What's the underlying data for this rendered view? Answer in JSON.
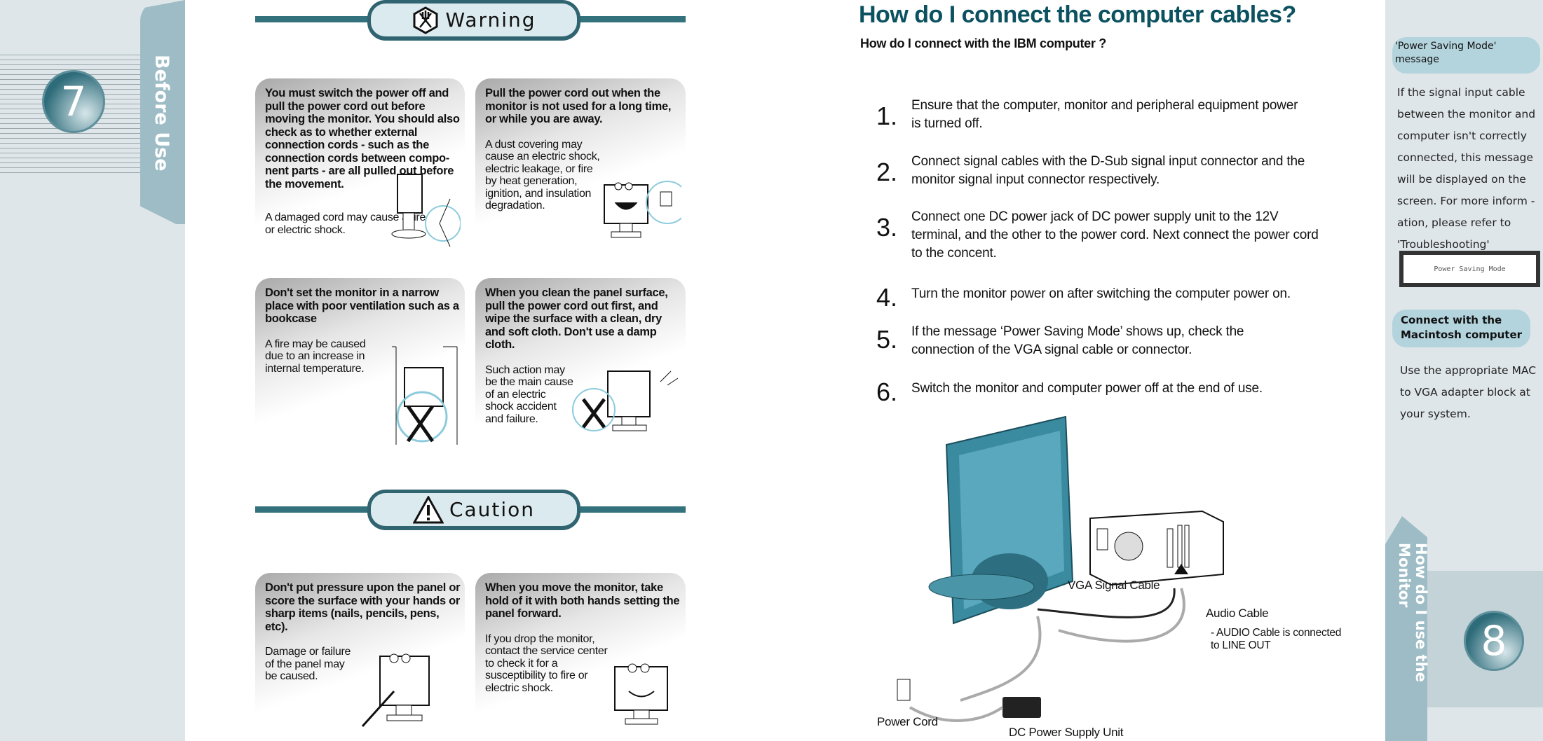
{
  "left_page": {
    "page_number": "7",
    "section_tab": "Before Use",
    "warning_heading": "Warning",
    "caution_heading": "Caution",
    "warning_cards": [
      {
        "heading": "You must switch the power off and pull the  power cord out before moving the monitor. You should also check as to whether external connection cords - such as the connection cords between compo-nent parts - are all pulled out before the movement.",
        "body": "A damaged cord may cause a fire or electric shock."
      },
      {
        "heading": "Pull the power cord out when the monitor is not used for a long time, or  while you are away.",
        "body": "A dust covering may cause an electric shock, electric leakage, or fire  by heat generation, ignition, and insulation degradation."
      },
      {
        "heading": "Don't set  the  monitor in   a narrow place   with poor  ventilation such as  a bookcase",
        "body": "A fire may be caused due to an increase in internal temperature."
      },
      {
        "heading": "When you clean the panel surface, pull the power cord  out first, and wipe the surface with a clean, dry and soft cloth. Don't use a damp cloth.",
        "body": "Such action may be the main cause of an electric shock accident and failure."
      }
    ],
    "caution_cards": [
      {
        "heading": "Don't put pressure  upon the  panel or  score the  surface with  your hands or sharp items (nails, pencils, pens, etc).",
        "body": "Damage or failure of the panel may be caused."
      },
      {
        "heading": "When you move the monitor, take hold  of it with both hands setting the panel forward.",
        "body": "If  you  drop  the  monitor, contact  the  service center   to check it for a susceptibility to fire or electric shock."
      }
    ]
  },
  "right_page": {
    "title": "How do I connect the computer cables?",
    "subtitle": "How do I connect with the IBM computer ?",
    "steps": [
      {
        "num": "1.",
        "text": "Ensure that the computer, monitor  and peripheral equipment power is turned off."
      },
      {
        "num": "2.",
        "text": "Connect signal cables with the D-Sub signal input connector  and the monitor signal input connector respectively."
      },
      {
        "num": "3.",
        "text": "Connect one DC power jack of DC  power supply unit  to the 12V terminal, and  the other to the power cord. Next connect the power cord to the concent."
      },
      {
        "num": "4.",
        "text": "Turn the monitor power on after switching the computer power on."
      },
      {
        "num": "5.",
        "text": "If the  message ‘Power Saving Mode’ shows up, check  the  connection of the VGA signal cable or connector."
      },
      {
        "num": "6.",
        "text": "Switch the monitor and computer power off at the end of use."
      }
    ],
    "diagram_labels": {
      "vga": "VGA Signal Cable",
      "audio": "Audio Cable",
      "audio_note": "- AUDIO Cable is connected to LINE OUT",
      "power_cord": "Power Cord",
      "dc_unit": "DC Power Supply Unit"
    },
    "sidebar": {
      "psm_heading": "'Power Saving Mode' message",
      "psm_text": "If the  signal input   cable between the   monitor and computer  isn't correctly connected, this message will be  displayed on the screen. For  more inform -ation, please refer to 'Troubleshooting'",
      "psm_screen": "Power Saving Mode",
      "mac_heading": "Connect with the Macintosh computer",
      "mac_text": "Use the appropriate MAC to VGA adapter block at your  system."
    },
    "page_number": "8",
    "section_tab": "How do I use the Monitor"
  },
  "colors": {
    "accent": "#0b5160",
    "tab": "#9dbcc5",
    "bar": "#33717d",
    "sidebar_bg": "#dfe6e9"
  }
}
